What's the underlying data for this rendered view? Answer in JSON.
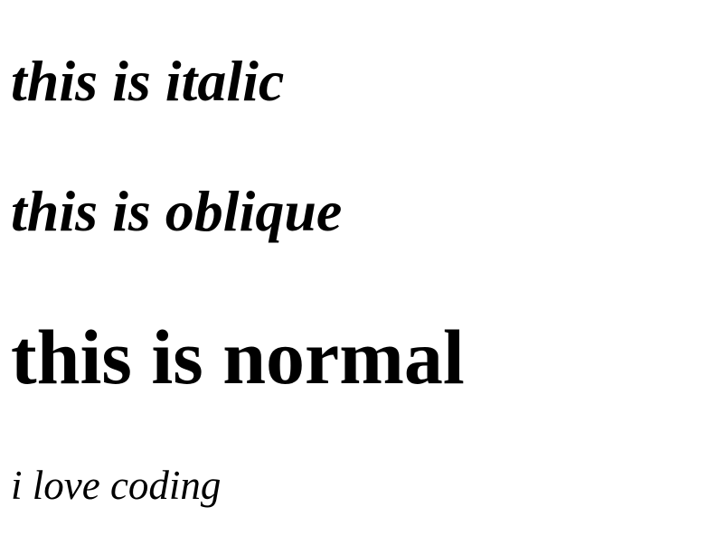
{
  "lines": {
    "italic": "this is italic",
    "oblique": "this is oblique",
    "normal": "this is normal",
    "coding": "i love coding"
  }
}
